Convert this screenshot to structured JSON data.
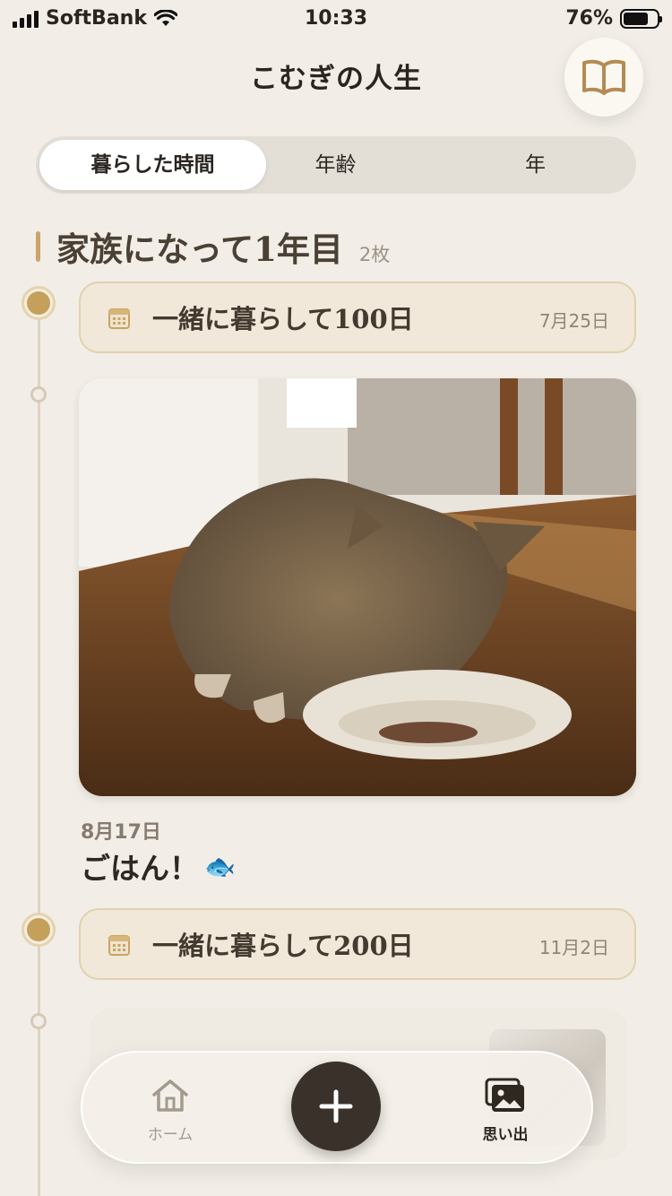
{
  "status_bar": {
    "carrier": "SoftBank",
    "time": "10:33",
    "battery": "76%",
    "battery_level": 0.76
  },
  "header": {
    "title": "こむぎの人生",
    "book_icon": "open-book-icon"
  },
  "segments": [
    {
      "label": "暮らした時間",
      "active": true
    },
    {
      "label": "年齢",
      "active": false
    },
    {
      "label": "年",
      "active": false
    }
  ],
  "section": {
    "title": "家族になって1年目",
    "count": "2枚"
  },
  "milestones": [
    {
      "title": "一緒に暮らして100日",
      "date": "7月25日"
    },
    {
      "title": "一緒に暮らして200日",
      "date": "11月2日"
    }
  ],
  "post": {
    "date": "8月17日",
    "text": "ごはん！",
    "emoji": "🐟",
    "photo": "kitten-eating-from-bowl"
  },
  "tab_bar": {
    "home_label": "ホーム",
    "add_icon": "plus-icon",
    "memories_label": "思い出"
  },
  "colors": {
    "background": "#f2eee7",
    "accent_gold": "#c4a05a",
    "fab": "#3a312a"
  }
}
